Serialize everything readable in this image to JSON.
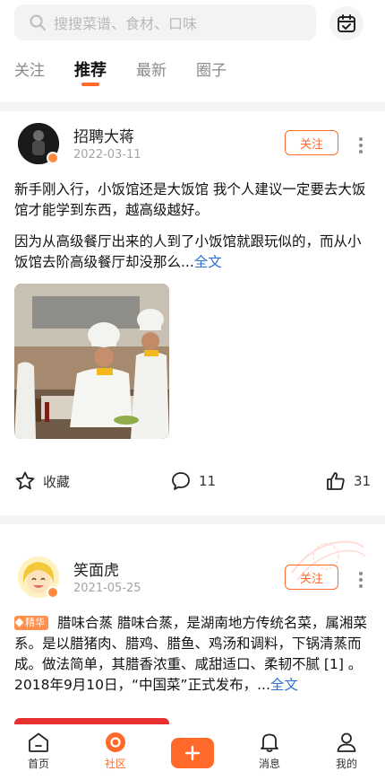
{
  "search": {
    "placeholder": "搜搜菜谱、食材、口味"
  },
  "tabs": [
    {
      "label": "关注"
    },
    {
      "label": "推荐"
    },
    {
      "label": "最新"
    },
    {
      "label": "圈子"
    }
  ],
  "posts": [
    {
      "username": "招聘大蒋",
      "date": "2022-03-11",
      "follow_label": "关注",
      "line1": "新手刚入行，小饭馆还是大饭馆  我个人建议一定要去大饭馆才能学到东西，越高级越好。",
      "line2": "因为从高级餐厅出来的人到了小饭馆就跟玩似的，而从小饭馆去阶高级餐厅却没那么...",
      "full_label": "全文",
      "avatar_text": "招聘大蒋",
      "collect_label": "收藏",
      "comments": "11",
      "likes": "31"
    },
    {
      "username": "笑面虎",
      "date": "2021-05-25",
      "follow_label": "关注",
      "badge": "精华",
      "line1": "腊味合蒸  腊味合蒸，是湖南地方传统名菜，属湘菜系。是以腊猪肉、腊鸡、腊鱼、鸡汤和调料，下锅清蒸而成。做法简单，其腊香浓重、咸甜适口、柔韧不腻 [1] 。",
      "line2": "2018年9月10日，“中国菜”正式发布，...",
      "full_label": "全文",
      "stamp_text": "精华"
    }
  ],
  "bottom_nav": [
    {
      "label": "首页",
      "icon": "home-icon"
    },
    {
      "label": "社区",
      "icon": "community-icon"
    },
    {
      "label": "",
      "icon": "plus-icon"
    },
    {
      "label": "消息",
      "icon": "bell-icon"
    },
    {
      "label": "我的",
      "icon": "user-icon"
    }
  ],
  "colors": {
    "accent": "#ff6a2b",
    "link": "#2f6fd6",
    "badge": "#ff8f4a"
  }
}
